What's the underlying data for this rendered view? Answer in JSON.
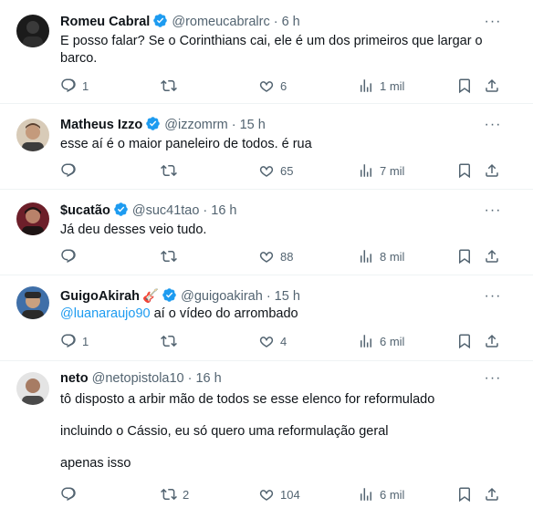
{
  "tweets": [
    {
      "name": "Romeu Cabral",
      "verified": true,
      "handle": "@romeucabralrc",
      "time": "6 h",
      "text_lines": [
        "E posso falar? Se o Corinthians cai, ele é um dos primeiros que largar o",
        "barco."
      ],
      "replies": "1",
      "retweets": "",
      "likes": "6",
      "views": "1 mil"
    },
    {
      "name": "Matheus Izzo",
      "verified": true,
      "handle": "@izzomrm",
      "time": "15 h",
      "text_lines": [
        "esse aí é o maior paneleiro de todos. é rua"
      ],
      "replies": "",
      "retweets": "",
      "likes": "65",
      "views": "7 mil"
    },
    {
      "name": "$ucatão",
      "verified": true,
      "handle": "@suc41tao",
      "time": "16 h",
      "text_lines": [
        "Já deu desses veio tudo."
      ],
      "replies": "",
      "retweets": "",
      "likes": "88",
      "views": "8 mil"
    },
    {
      "name": "GuigoAkirah",
      "name_emoji": "🎸",
      "verified": true,
      "handle": "@guigoakirah",
      "time": "15 h",
      "mention": "@luanaraujo90",
      "text_after_mention": " aí o vídeo do arrombado",
      "replies": "1",
      "retweets": "",
      "likes": "4",
      "views": "6 mil"
    },
    {
      "name": "neto",
      "verified": false,
      "handle": "@netopistola10",
      "time": "16 h",
      "text_lines": [
        "tô disposto a arbir mão de todos se esse elenco for reformulado",
        "incluindo o Cássio, eu só quero uma reformulação geral",
        "apenas isso"
      ],
      "replies": "",
      "retweets": "2",
      "likes": "104",
      "views": "6 mil"
    }
  ],
  "separator": "·",
  "icons": {
    "more": "more-horizontal-icon",
    "reply": "reply-icon",
    "retweet": "retweet-icon",
    "like": "heart-icon",
    "views": "views-icon",
    "bookmark": "bookmark-icon",
    "share": "share-icon",
    "verified": "verified-badge-icon"
  },
  "colors": {
    "text": "#0f1419",
    "muted": "#536471",
    "accent": "#1d9bf0",
    "divider": "#eff3f4"
  }
}
